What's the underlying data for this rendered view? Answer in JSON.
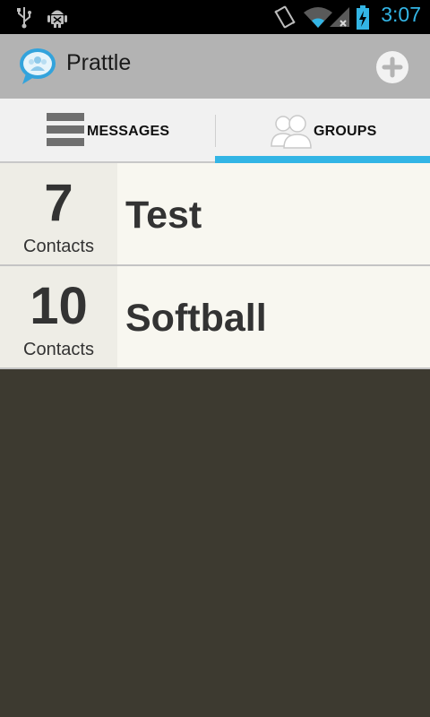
{
  "status_bar": {
    "time": "3:07",
    "time_color": "#33b5e5",
    "icons": [
      "usb-icon",
      "android-debug-icon",
      "vibrate-icon",
      "wifi-icon",
      "signal-icon",
      "battery-charging-icon"
    ]
  },
  "app": {
    "title": "Prattle",
    "logo": "prattle-logo",
    "action_icon": "add-icon"
  },
  "tabs": [
    {
      "label": "MESSAGES",
      "icon": "list-icon",
      "selected": false
    },
    {
      "label": "GROUPS",
      "icon": "people-icon",
      "selected": true
    }
  ],
  "accent_color": "#33b5e5",
  "groups": [
    {
      "count": "7",
      "count_label": "Contacts",
      "name": "Test"
    },
    {
      "count": "10",
      "count_label": "Contacts",
      "name": "Softball"
    }
  ]
}
